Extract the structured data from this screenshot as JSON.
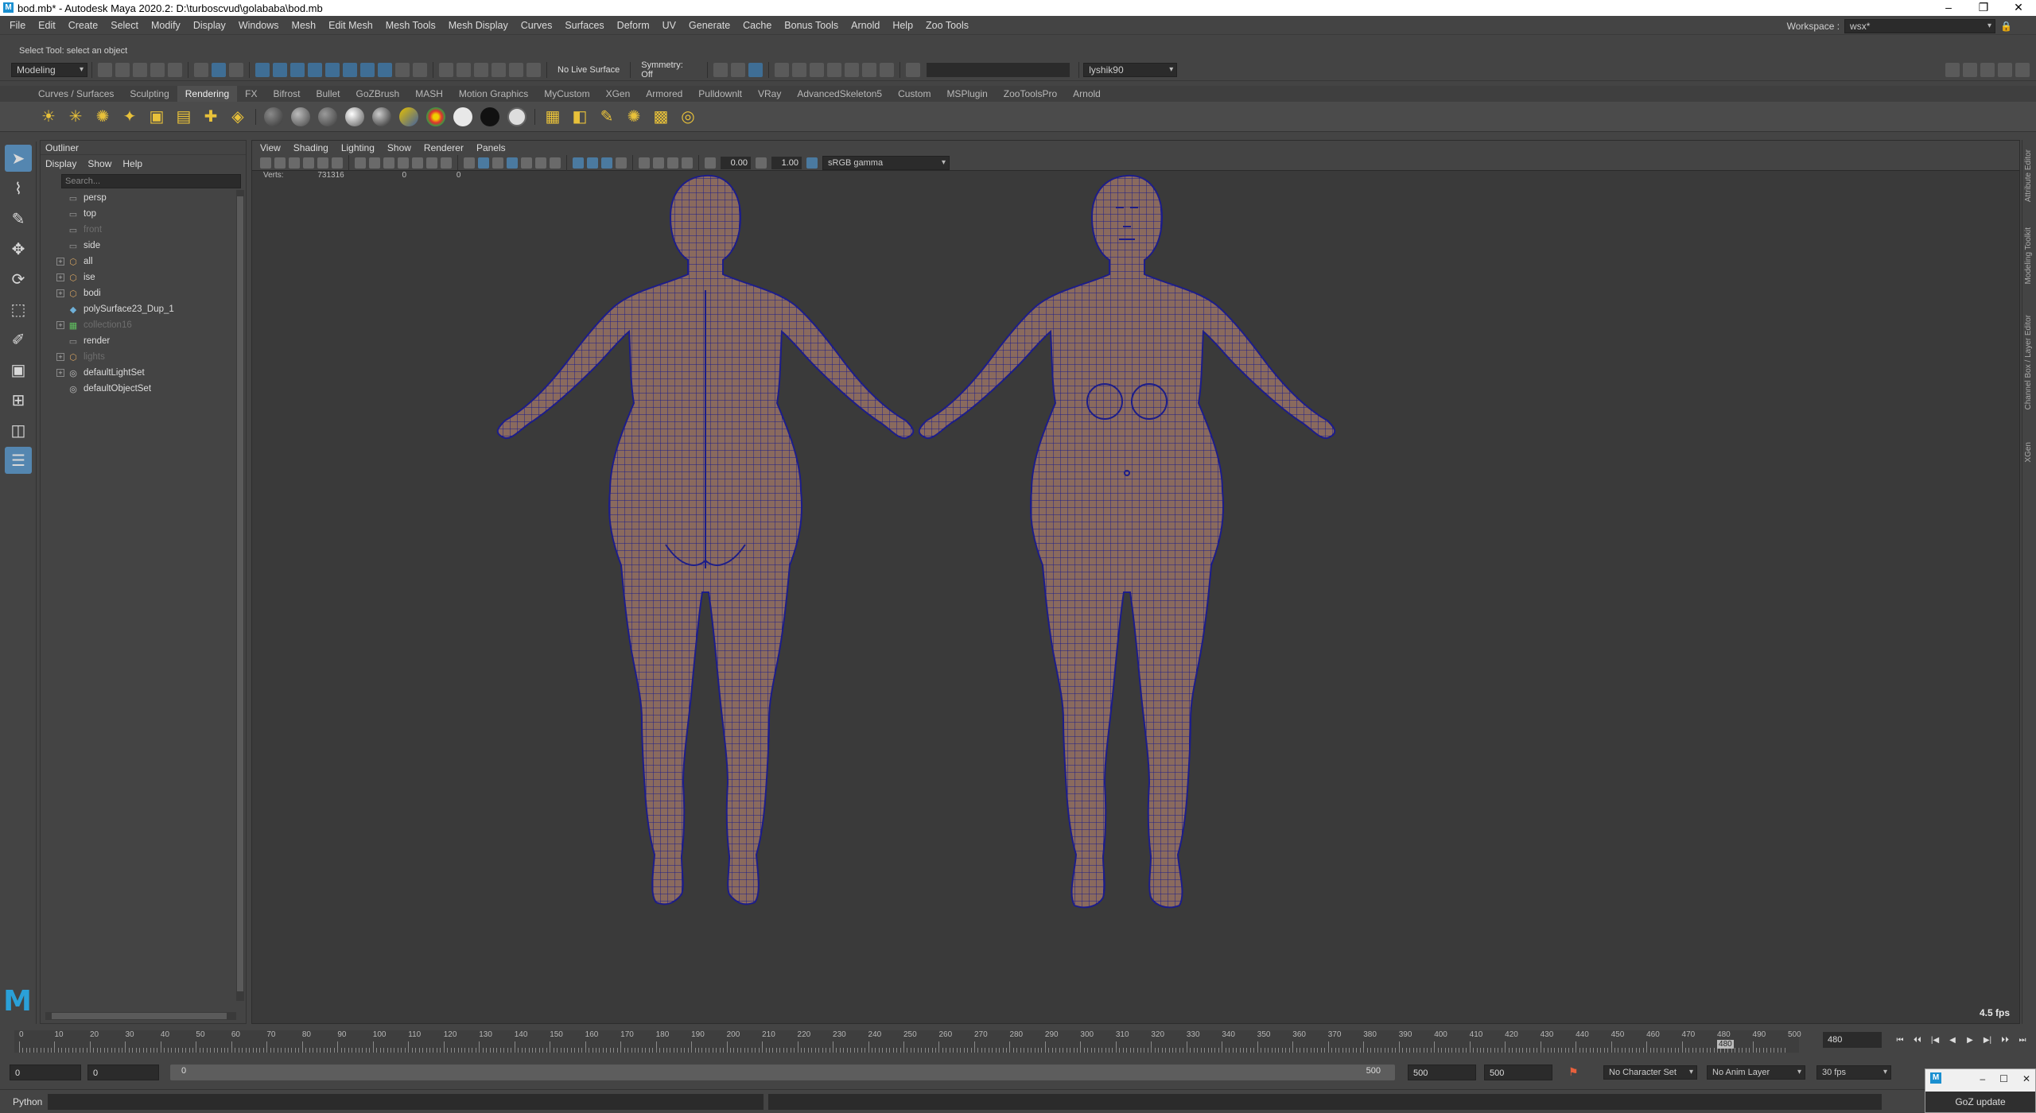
{
  "window": {
    "title": "bod.mb* - Autodesk Maya 2020.2: D:\\turboscvud\\golababa\\bod.mb",
    "logo": "M",
    "controls": [
      "–",
      "❐",
      "✕"
    ]
  },
  "menu": {
    "items": [
      "File",
      "Edit",
      "Create",
      "Select",
      "Modify",
      "Display",
      "Windows",
      "Mesh",
      "Edit Mesh",
      "Mesh Tools",
      "Mesh Display",
      "Curves",
      "Surfaces",
      "Deform",
      "UV",
      "Generate",
      "Cache",
      "Bonus Tools",
      "Arnold",
      "Help",
      "Zoo Tools"
    ],
    "workspace_label": "Workspace :",
    "workspace_value": "wsx*"
  },
  "status": {
    "help_line": "Select Tool: select an object",
    "mode": "Modeling",
    "live_surface": "No Live Surface",
    "symmetry": "Symmetry: Off",
    "user": "lyshik90"
  },
  "shelf": {
    "tabs": [
      "Curves / Surfaces",
      "Sculpting",
      "Rendering",
      "FX",
      "Bifrost",
      "Bullet",
      "GoZBrush",
      "MASH",
      "Motion Graphics",
      "MyCustom",
      "XGen",
      "Armored",
      "Pulldownlt",
      "VRay",
      "AdvancedSkeleton5",
      "Custom",
      "MSPlugin",
      "ZooToolsPro",
      "Arnold"
    ],
    "active_tab": "Rendering"
  },
  "outliner": {
    "title": "Outliner",
    "menus": [
      "Display",
      "Show",
      "Help"
    ],
    "search_placeholder": "Search...",
    "items": [
      {
        "label": "persp",
        "icon": "camera-icon",
        "expand": false,
        "dim": false
      },
      {
        "label": "top",
        "icon": "camera-icon",
        "expand": false,
        "dim": false
      },
      {
        "label": "front",
        "icon": "camera-icon",
        "expand": false,
        "dim": true
      },
      {
        "label": "side",
        "icon": "camera-icon",
        "expand": false,
        "dim": false
      },
      {
        "label": "all",
        "icon": "group-icon",
        "expand": true,
        "dim": false
      },
      {
        "label": "ise",
        "icon": "group-icon",
        "expand": true,
        "dim": false
      },
      {
        "label": "bodi",
        "icon": "group-icon",
        "expand": true,
        "dim": false
      },
      {
        "label": "polySurface23_Dup_1",
        "icon": "mesh-icon",
        "expand": false,
        "dim": false
      },
      {
        "label": "collection16",
        "icon": "collection-icon",
        "expand": true,
        "dim": true
      },
      {
        "label": "render",
        "icon": "camera-icon",
        "expand": false,
        "dim": false
      },
      {
        "label": "lights",
        "icon": "group-icon",
        "expand": true,
        "dim": true
      },
      {
        "label": "defaultLightSet",
        "icon": "set-icon",
        "expand": true,
        "dim": false
      },
      {
        "label": "defaultObjectSet",
        "icon": "set-icon",
        "expand": false,
        "dim": false
      }
    ]
  },
  "viewport": {
    "menus": [
      "View",
      "Shading",
      "Lighting",
      "Show",
      "Renderer",
      "Panels"
    ],
    "exposure": "0.00",
    "gamma": "1.00",
    "color_space": "sRGB gamma",
    "hud_verts": "Verts:",
    "hud_value": "731316",
    "hud_zero1": "0",
    "hud_zero2": "0",
    "fps": "4.5 fps",
    "mesh_fill": "#8a6a5e",
    "wire_color": "#1c1d8a"
  },
  "right_tabs": [
    "Attribute Editor",
    "Modeling Toolkit",
    "Channel Box / Layer Editor",
    "XGen"
  ],
  "timeline": {
    "ticks": [
      0,
      10,
      20,
      30,
      40,
      50,
      60,
      70,
      80,
      90,
      100,
      110,
      120,
      130,
      140,
      150,
      160,
      170,
      180,
      190,
      200,
      210,
      220,
      230,
      240,
      250,
      260,
      270,
      280,
      290,
      300,
      310,
      320,
      330,
      340,
      350,
      360,
      370,
      380,
      390,
      400,
      410,
      420,
      430,
      440,
      450,
      460,
      470,
      480,
      490,
      500
    ],
    "current_frame": "480",
    "current_marker": "480",
    "playback_buttons": [
      "⏮",
      "⏴⏴",
      "|◀",
      "◀",
      "▶",
      "▶|",
      "⏵⏵",
      "⏭"
    ]
  },
  "range": {
    "start_outer": "0",
    "start_inner": "0",
    "track_start": "0",
    "track_end": "500",
    "end_inner": "500",
    "end_outer": "500",
    "character_set": "No Character Set",
    "anim_layer": "No Anim Layer",
    "fps": "30 fps"
  },
  "command": {
    "language": "Python"
  },
  "goz": {
    "badge": "M",
    "label": "GoZ update"
  }
}
